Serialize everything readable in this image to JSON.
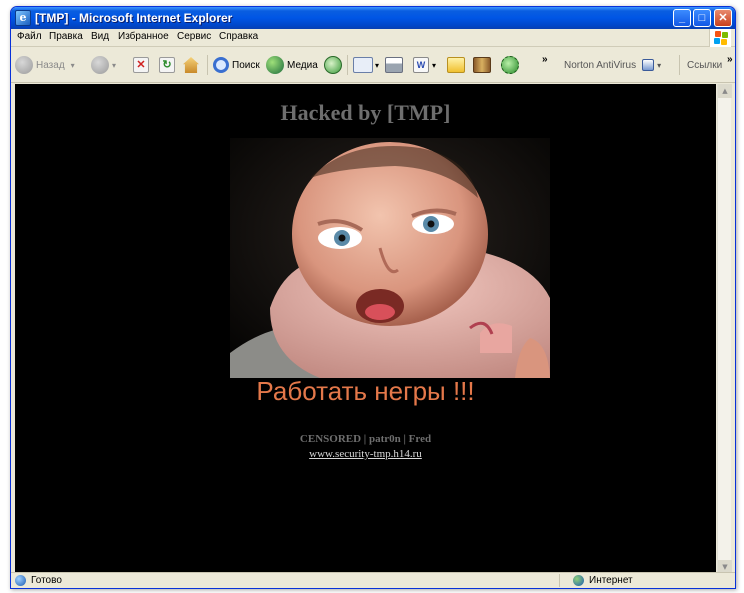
{
  "window": {
    "title": "[TMP] - Microsoft Internet Explorer",
    "min_label": "_",
    "max_label": "□",
    "close_label": "✕"
  },
  "menu": {
    "items": [
      "Файл",
      "Правка",
      "Вид",
      "Избранное",
      "Сервис",
      "Справка"
    ]
  },
  "toolbar": {
    "back_label": "Назад",
    "search_label": "Поиск",
    "media_label": "Медиа",
    "chevron": "»",
    "norton_label": "Norton AntiVirus",
    "links_label": "Ссылки",
    "links_chevron": "»"
  },
  "page": {
    "heading": "Hacked by [TMP]",
    "slogan": "Работать негры !!!",
    "credits": "CENSORED | patr0n | Fred",
    "link": "www.security-tmp.h14.ru",
    "background_color": "#000000",
    "slogan_color": "#e4784a",
    "heading_color": "#6e6e6e"
  },
  "status": {
    "text": "Готово",
    "zone": "Интернет"
  }
}
